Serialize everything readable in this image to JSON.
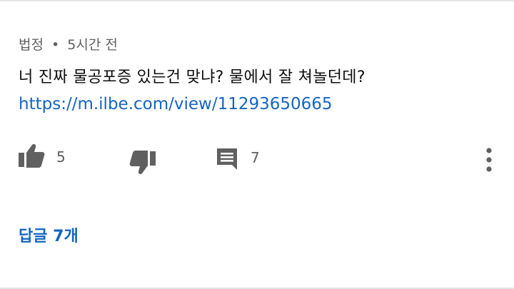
{
  "comment": {
    "author": "법정",
    "separator": "•",
    "time": "5시간 전",
    "text": "너 진짜 물공포증 있는건 맞냐? 물에서 잘 쳐놀던데?",
    "link": "https://m.ilbe.com/view/11293650665"
  },
  "actions": {
    "like_count": "5",
    "reply_count": "7",
    "icons": {
      "like": "thumbs-up-icon",
      "dislike": "thumbs-down-icon",
      "reply": "comment-icon",
      "more": "more-vertical-icon"
    }
  },
  "replies": {
    "label": "답글 7개"
  },
  "colors": {
    "link": "#1565c0",
    "meta": "#606060",
    "icon": "#606060",
    "border": "#e4e4e4"
  }
}
